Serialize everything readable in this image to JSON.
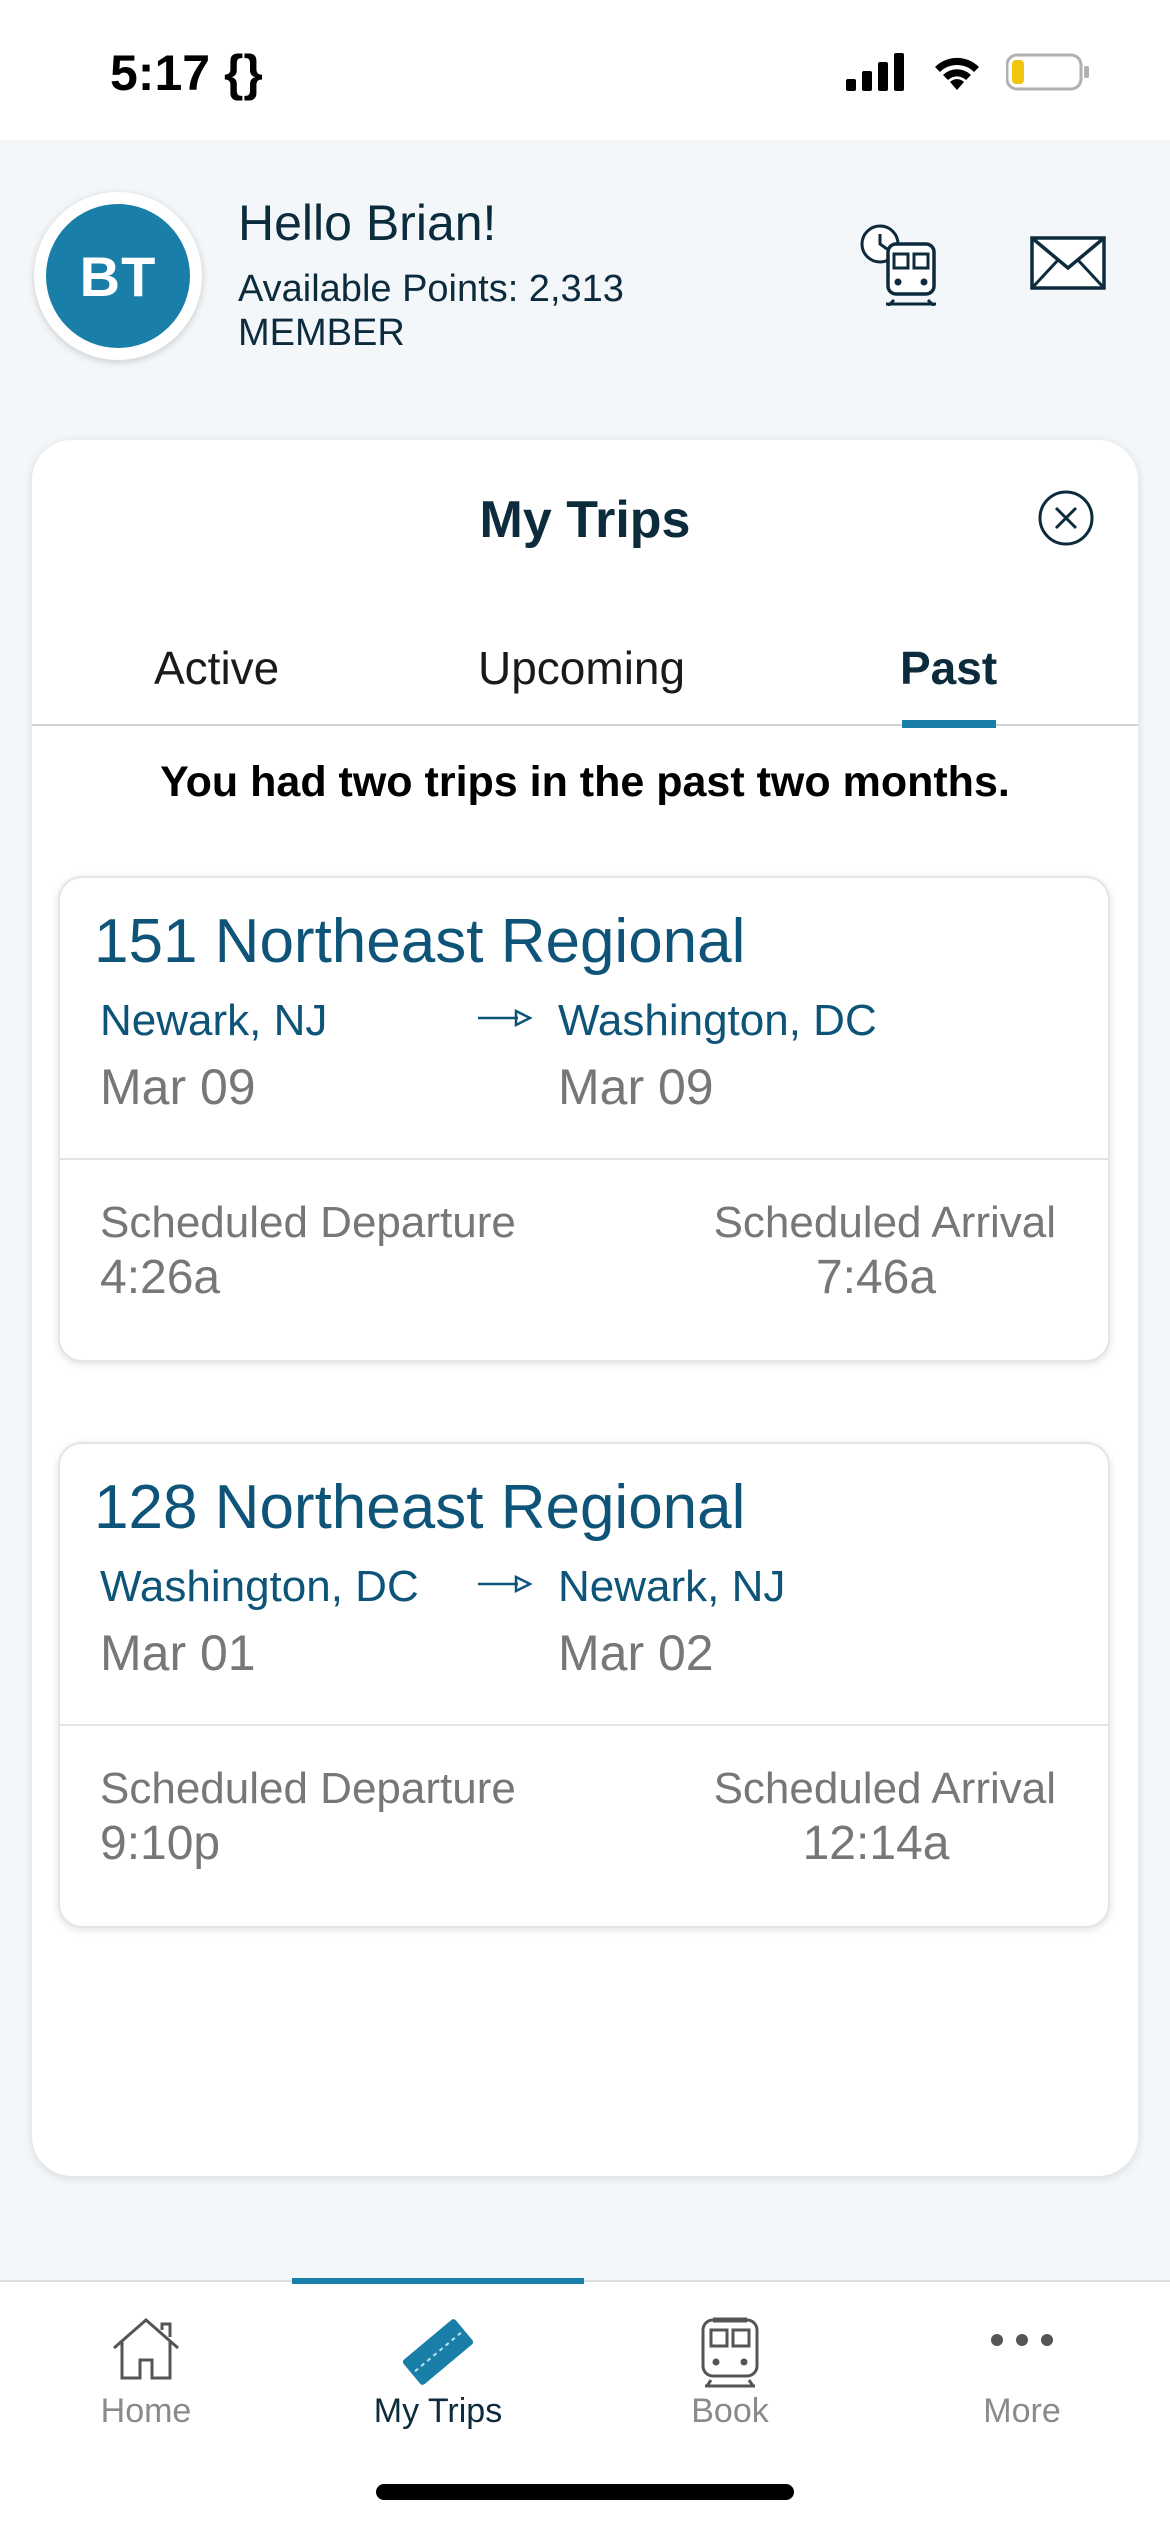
{
  "status_bar": {
    "time": "5:17 {}"
  },
  "header": {
    "avatar_initials": "BT",
    "greeting": "Hello Brian!",
    "points": "Available Points: 2,313",
    "tier": "MEMBER",
    "icons": [
      "train-history-icon",
      "mail-icon"
    ]
  },
  "panel": {
    "title": "My Trips",
    "tabs": [
      {
        "label": "Active"
      },
      {
        "label": "Upcoming"
      },
      {
        "label": "Past"
      }
    ],
    "active_tab": "Past",
    "summary": "You had two trips in the past two months.",
    "trips": [
      {
        "name": "151 Northeast Regional",
        "origin": "Newark, NJ",
        "destination": "Washington, DC",
        "origin_date": "Mar 09",
        "destination_date": "Mar 09",
        "departure_label": "Scheduled Departure",
        "departure_time": "4:26a",
        "arrival_label": "Scheduled Arrival",
        "arrival_time": "7:46a"
      },
      {
        "name": "128 Northeast Regional",
        "origin": "Washington, DC",
        "destination": "Newark, NJ",
        "origin_date": "Mar 01",
        "destination_date": "Mar 02",
        "departure_label": "Scheduled Departure",
        "departure_time": "9:10p",
        "arrival_label": "Scheduled Arrival",
        "arrival_time": "12:14a"
      }
    ]
  },
  "bottom_nav": {
    "items": [
      {
        "label": "Home",
        "icon": "home-icon"
      },
      {
        "label": "My Trips",
        "icon": "ticket-icon"
      },
      {
        "label": "Book",
        "icon": "train-icon"
      },
      {
        "label": "More",
        "icon": "more-dots-icon"
      }
    ],
    "active": "My Trips"
  },
  "colors": {
    "accent": "#1a7fa8",
    "link": "#0d5478",
    "text_dark": "#0c2b3d",
    "muted": "#777777"
  }
}
